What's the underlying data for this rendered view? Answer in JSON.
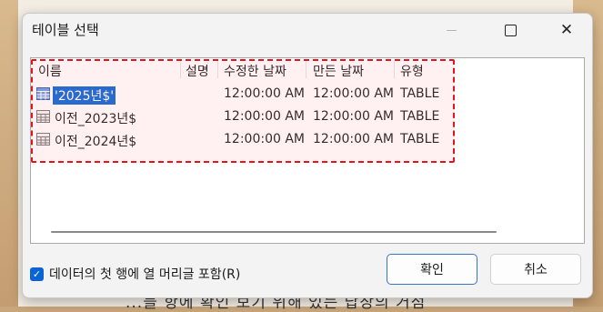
{
  "dialog": {
    "title": "테이블 선택",
    "minimize_icon": "minimize-icon",
    "maximize_icon": "maximize-icon",
    "close_icon": "close-icon"
  },
  "table": {
    "columns": [
      "이름",
      "설명",
      "수정한 날짜",
      "만든 날짜",
      "유형"
    ],
    "rows": [
      {
        "name": "'2025년$'",
        "description": "",
        "modified": "12:00:00 AM",
        "created": "12:00:00 AM",
        "type": "TABLE",
        "selected": true
      },
      {
        "name": "이전_2023년$",
        "description": "",
        "modified": "12:00:00 AM",
        "created": "12:00:00 AM",
        "type": "TABLE",
        "selected": false
      },
      {
        "name": "이전_2024년$",
        "description": "",
        "modified": "12:00:00 AM",
        "created": "12:00:00 AM",
        "type": "TABLE",
        "selected": false
      }
    ]
  },
  "options": {
    "first_row_headers_label": "데이터의 첫 행에 열 머리글 포함(R)",
    "first_row_headers_checked": true
  },
  "buttons": {
    "ok_label": "확인",
    "cancel_label": "취소"
  },
  "background_text": "...블 항에 확인 보기 위해 있는 답장의 거점",
  "colors": {
    "accent": "#0a64d6",
    "highlight_border": "#e0141e"
  }
}
